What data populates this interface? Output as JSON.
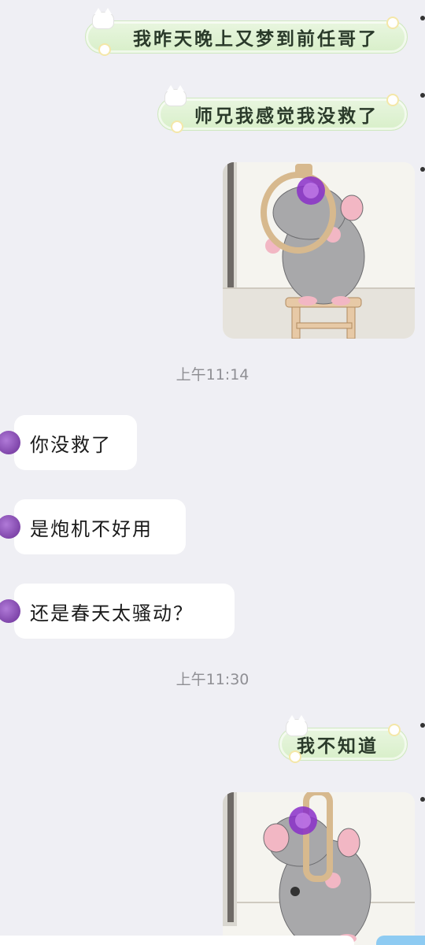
{
  "messages": {
    "out1": "我昨天晚上又梦到前任哥了",
    "out2": "师兄我感觉我没救了",
    "in1": "你没救了",
    "in2": "是炮机不好用",
    "in3": "还是春天太骚动？",
    "out3": "我不知道"
  },
  "timestamps": {
    "t1": "上午11:14",
    "t2": "上午11:30"
  },
  "images": {
    "sticker1": "rat-noose-sticker",
    "sticker2": "rat-noose-sticker"
  },
  "colors": {
    "background": "#efeff4",
    "sticker_green": "#d8efc9",
    "incoming_bubble": "#ffffff",
    "avatar_purple": "#8a4bbb",
    "timestamp": "#8f8f94"
  }
}
